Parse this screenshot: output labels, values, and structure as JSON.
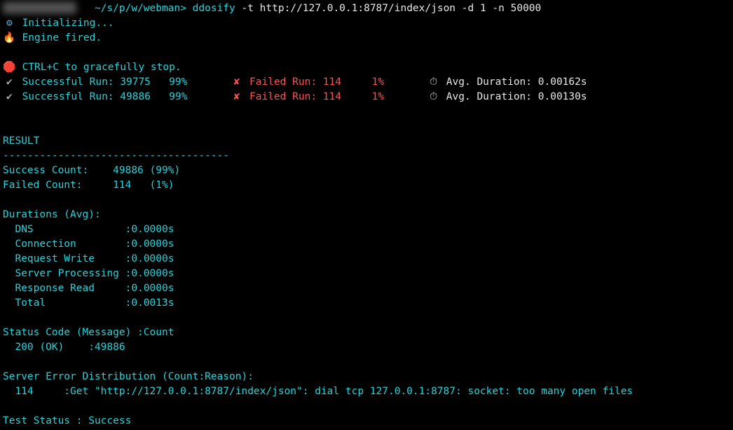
{
  "prompt": {
    "hidden_user": "████████████",
    "path": "~/s/p/w/webman",
    "sep": ">",
    "cmd": "ddosify",
    "args": " -t http://127.0.0.1:8787/index/json -d 1 -n 50000"
  },
  "init": {
    "line1": "Initializing...",
    "line2": "Engine fired."
  },
  "stop_hint": "CTRL+C to gracefully stop.",
  "runs": [
    {
      "success_label": "Successful Run:",
      "success_count": "39775",
      "success_pct": "99%",
      "failed_label": "Failed Run:",
      "failed_count": "114",
      "failed_pct": "1%",
      "avg_label": "Avg. Duration:",
      "avg_value": "0.00162s"
    },
    {
      "success_label": "Successful Run:",
      "success_count": "49886",
      "success_pct": "99%",
      "failed_label": "Failed Run:",
      "failed_count": "114",
      "failed_pct": "1%",
      "avg_label": "Avg. Duration:",
      "avg_value": "0.00130s"
    }
  ],
  "result_header": "RESULT",
  "divider": "-------------------------------------",
  "summary": {
    "success_label": "Success Count:",
    "success_value": "49886 (99%)",
    "failed_label": "Failed Count:",
    "failed_value": "114   (1%)"
  },
  "durations_header": "Durations (Avg):",
  "durations": [
    {
      "name": "DNS",
      "value": "0.0000s"
    },
    {
      "name": "Connection",
      "value": "0.0000s"
    },
    {
      "name": "Request Write",
      "value": "0.0000s"
    },
    {
      "name": "Server Processing",
      "value": "0.0000s"
    },
    {
      "name": "Response Read",
      "value": "0.0000s"
    },
    {
      "name": "Total",
      "value": "0.0013s"
    }
  ],
  "status_code_header": "Status Code (Message) :Count",
  "status_code_line": "  200 (OK)    :49886",
  "error_dist_header": "Server Error Distribution (Count:Reason):",
  "error_dist_line": "  114     :Get \"http://127.0.0.1:8787/index/json\": dial tcp 127.0.0.1:8787: socket: too many open files",
  "test_status": "Test Status : Success",
  "icons": {
    "gear": "⚙",
    "fire": "🔥",
    "stop": "🛑",
    "check": "✔",
    "cross": "✘",
    "stopwatch": "⏱"
  }
}
